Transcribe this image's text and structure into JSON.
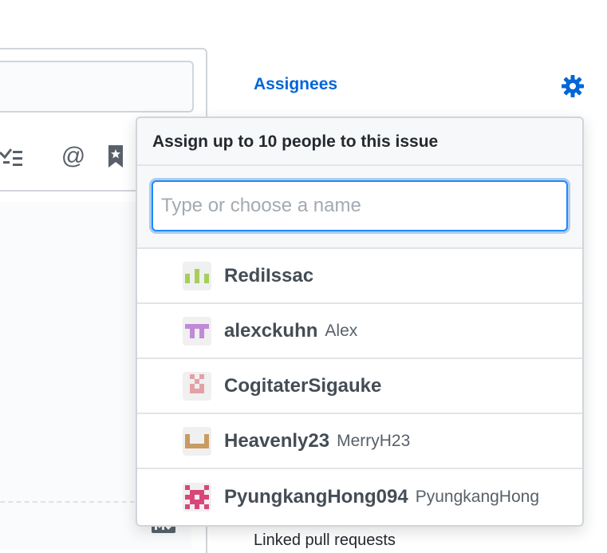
{
  "editor": {
    "mention_glyph": "@",
    "toolbar_icons": [
      "tasklist-icon",
      "mention-icon",
      "bookmark-icon"
    ],
    "footer_icon": "markdown-icon"
  },
  "sidebar": {
    "assignees_heading": "Assignees",
    "settings_icon": "gear-icon",
    "linked_heading": "Linked pull requests",
    "accent_color": "#0366d6"
  },
  "assignee_popover": {
    "header": "Assign up to 10 people to this issue",
    "filter_placeholder": "Type or choose a name",
    "filter_value": "",
    "users": [
      {
        "login": "RediIssac",
        "name": "",
        "avatar_color": "#a5cf5a"
      },
      {
        "login": "alexckuhn",
        "name": "Alex",
        "avatar_color": "#c08ad8"
      },
      {
        "login": "CogitaterSigauke",
        "name": "",
        "avatar_color": "#e3a1a6"
      },
      {
        "login": "Heavenly23",
        "name": "MerryH23",
        "avatar_color": "#c99b62"
      },
      {
        "login": "PyungkangHong094",
        "name": "PyungkangHong",
        "avatar_color": "#d9467a"
      }
    ]
  }
}
